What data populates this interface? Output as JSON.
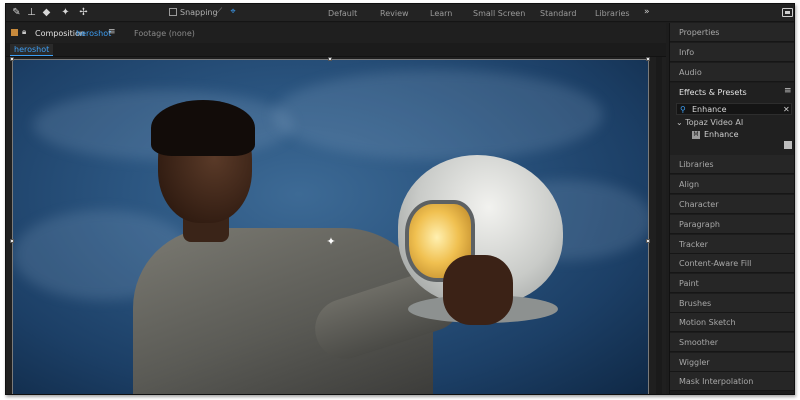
{
  "toolbar": {
    "tools": [
      {
        "icon": "brush-icon",
        "glyph": "✎"
      },
      {
        "icon": "stamp-icon",
        "glyph": "⊥"
      },
      {
        "icon": "eraser-icon",
        "glyph": "◆"
      },
      {
        "icon": "roto-brush-icon",
        "glyph": "✦"
      },
      {
        "icon": "puppet-pin-icon",
        "glyph": "✢"
      }
    ],
    "snapping_label": "Snapping",
    "snapping_checked": false,
    "workspaces": [
      "Default",
      "Review",
      "Learn",
      "Small Screen",
      "Standard",
      "Libraries"
    ],
    "more_glyph": "»"
  },
  "composition": {
    "label": "Composition",
    "name": "heroshot",
    "footage_label": "Footage (none)",
    "tab": "heroshot",
    "accent_color": "#3d9ff5",
    "label_color": "#c88a3c"
  },
  "right_panel": {
    "top_items": [
      "Properties",
      "Info",
      "Audio"
    ],
    "effects": {
      "title": "Effects & Presets",
      "search_value": "Enhance",
      "folder": "Topaz Video AI",
      "item": "Enhance"
    },
    "bottom_items": [
      "Libraries",
      "Align",
      "Character",
      "Paragraph",
      "Tracker",
      "Content-Aware Fill",
      "Paint",
      "Brushes",
      "Motion Sketch",
      "Smoother",
      "Wiggler",
      "Mask Interpolation"
    ]
  }
}
